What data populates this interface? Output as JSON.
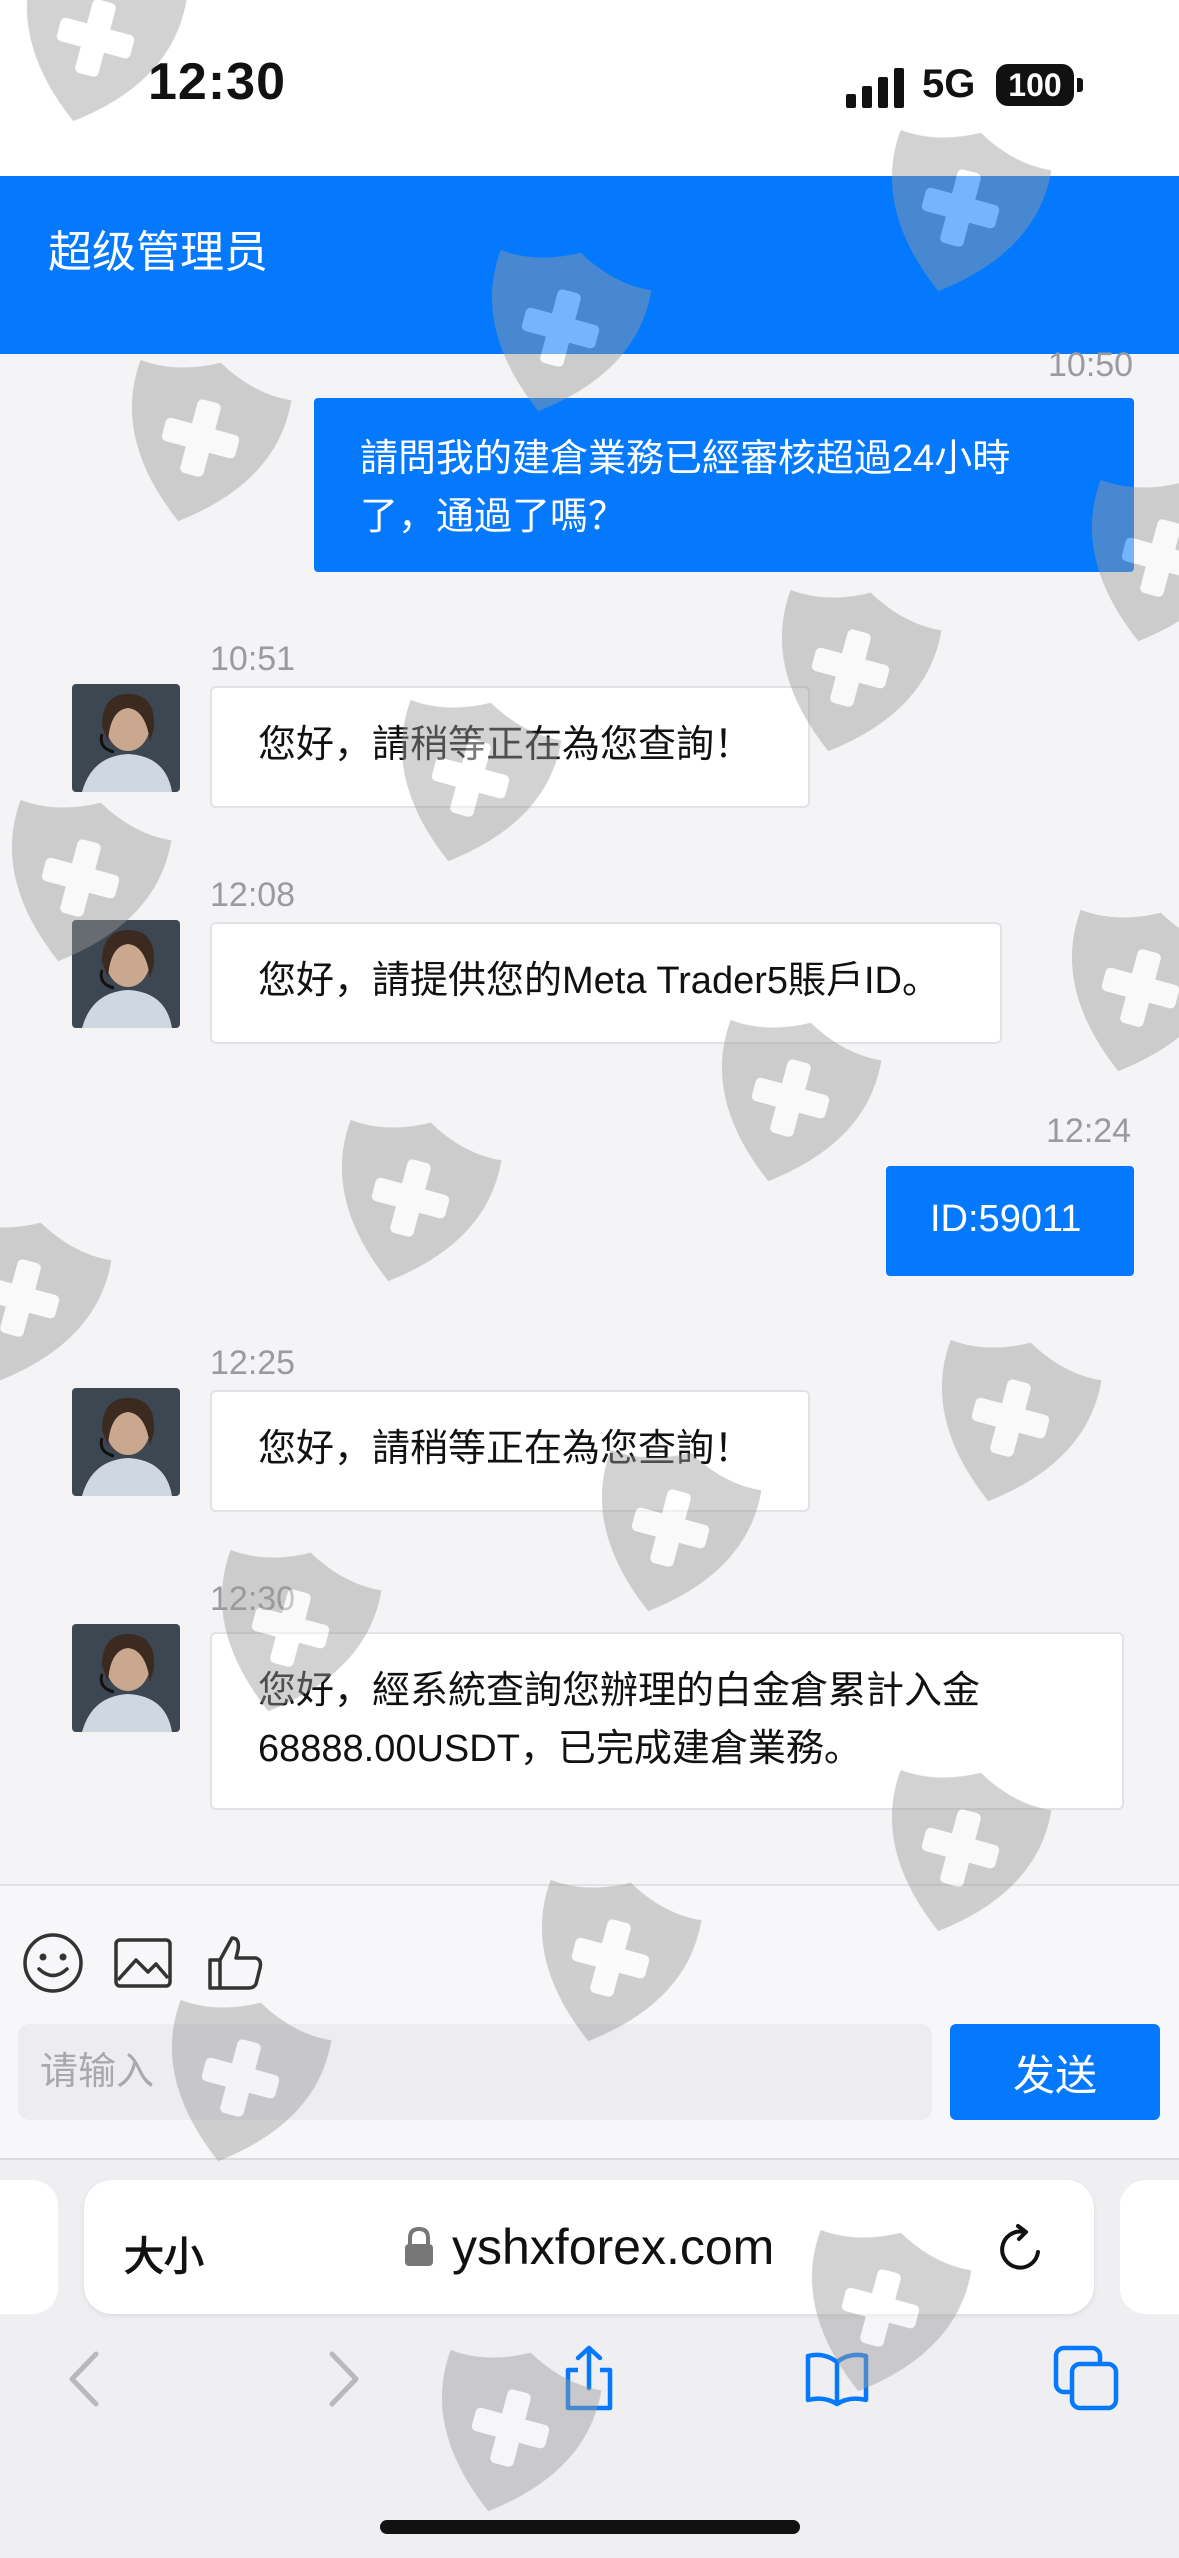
{
  "status_bar": {
    "time": "12:30",
    "network": "5G",
    "battery": "100"
  },
  "header": {
    "title": "超级管理员"
  },
  "chat": {
    "messages": [
      {
        "time": "10:50",
        "text_lines": [
          "請問我的建倉業務已經審核超過24小時",
          "了，通過了嗎？"
        ]
      },
      {
        "time": "10:51",
        "text_lines": [
          "您好，請稍等正在為您查詢！"
        ]
      },
      {
        "time": "12:08",
        "text_lines": [
          "您好，請提供您的Meta Trader5賬戶ID。"
        ]
      },
      {
        "time": "12:24",
        "text_lines": [
          "ID:59011"
        ]
      },
      {
        "time": "12:25",
        "text_lines": [
          "您好，請稍等正在為您查詢！"
        ]
      },
      {
        "time": "12:30",
        "text_lines": [
          "您好，經系統查詢您辦理的白金倉累計入金",
          "68888.00USDT，已完成建倉業務。"
        ]
      }
    ]
  },
  "input": {
    "placeholder": "请输入",
    "send_label": "发送"
  },
  "browser": {
    "text_size_label": "大小",
    "url": "yshxforex.com"
  },
  "colors": {
    "accent": "#0479fd",
    "chat_bg": "#f4f4f6"
  },
  "icons": [
    "signal-icon",
    "emoji-icon",
    "image-icon",
    "thumbs-up-icon",
    "lock-icon",
    "reload-icon",
    "back-icon",
    "forward-icon",
    "share-icon",
    "bookmarks-icon",
    "tabs-icon"
  ]
}
